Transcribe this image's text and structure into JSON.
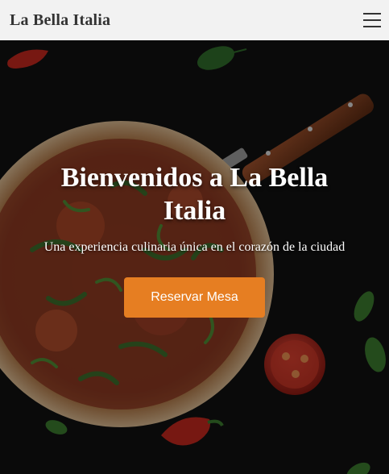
{
  "navbar": {
    "brand": "La Bella Italia",
    "menu_icon": "hamburger-menu-icon"
  },
  "hero": {
    "title": "Bienvenidos a La Bella Italia",
    "subtitle": "Una experiencia culinaria única en el corazón de la ciudad",
    "cta_label": "Reservar Mesa",
    "background_image": "pizza-on-dark-table"
  },
  "colors": {
    "navbar_bg": "#f2f2f2",
    "brand_text": "#333333",
    "cta_bg": "#e67e22",
    "cta_text": "#ffffff",
    "hero_text": "#ffffff"
  }
}
